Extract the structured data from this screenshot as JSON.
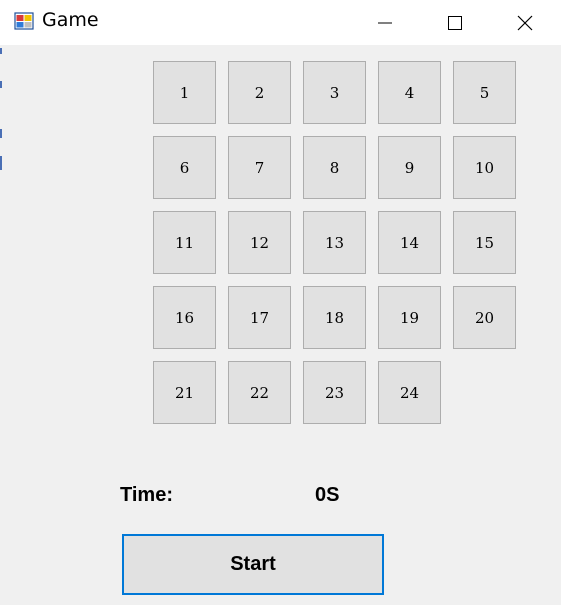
{
  "window": {
    "title": "Game",
    "app_icon": "winforms-app-icon",
    "controls": {
      "minimize_icon": "minimize-icon",
      "maximize_icon": "maximize-icon",
      "close_icon": "close-icon"
    }
  },
  "board": {
    "tiles": [
      "1",
      "2",
      "3",
      "4",
      "5",
      "6",
      "7",
      "8",
      "9",
      "10",
      "11",
      "12",
      "13",
      "14",
      "15",
      "16",
      "17",
      "18",
      "19",
      "20",
      "21",
      "22",
      "23",
      "24"
    ],
    "empty_slot": "row 5, column 5"
  },
  "timer": {
    "label": "Time:",
    "value": "0S"
  },
  "start_button": {
    "label": "Start"
  },
  "colors": {
    "window_background": "#f0f0f0",
    "titlebar_background": "#ffffff",
    "tile_background": "#e1e1e1",
    "tile_border": "#adadad",
    "focus_border": "#0078d7"
  }
}
